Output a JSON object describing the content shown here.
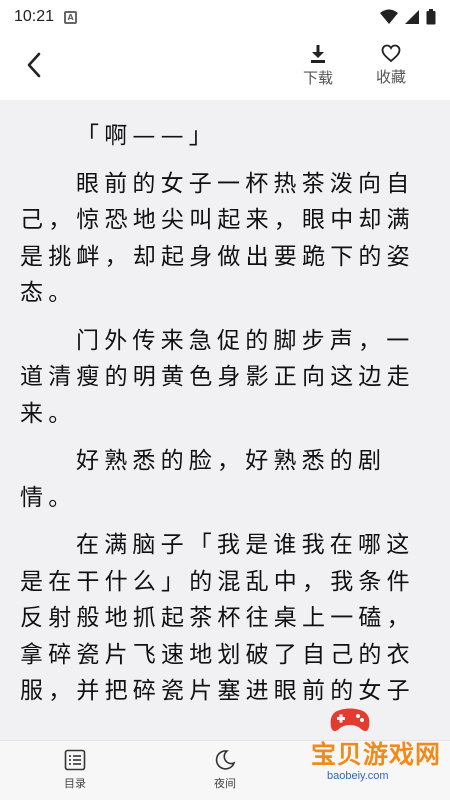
{
  "status_bar": {
    "time": "10:21",
    "notification_icon": "A"
  },
  "top_bar": {
    "download_label": "下载",
    "favorite_label": "收藏"
  },
  "content": {
    "paragraphs": [
      "「啊——」",
      "眼前的女子一杯热茶泼向自己，惊恐地尖叫起来，眼中却满是挑衅，却起身做出要跪下的姿态。",
      "门外传来急促的脚步声，一道清瘦的明黄色身影正向这边走来。",
      "好熟悉的脸，好熟悉的剧情。",
      "在满脑子「我是谁我在哪这是在干什么」的混乱中，我条件反射般地抓起茶杯往桌上一磕，拿碎瓷片飞速地划破了自己的衣服，并把碎瓷片塞进眼前的女子"
    ]
  },
  "bottom_bar": {
    "toc_label": "目录",
    "night_label": "夜间"
  },
  "watermark": {
    "title": "宝贝游戏网",
    "url": "baobeiy.com"
  }
}
